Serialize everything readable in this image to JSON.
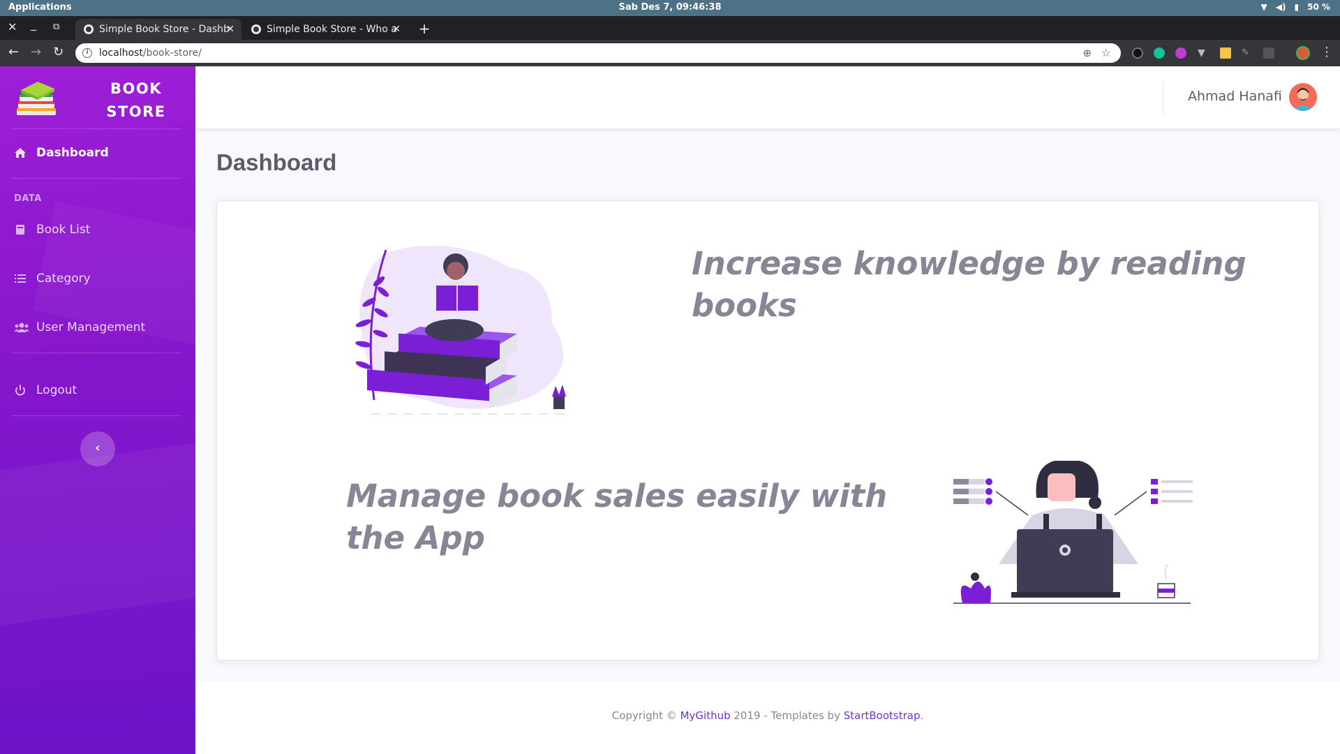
{
  "os": {
    "apps_label": "Applications",
    "clock": "Sab Des  7, 09:46:38",
    "battery": "50 %"
  },
  "browser": {
    "tabs": [
      {
        "label": "Simple Book Store - Dashb",
        "active": true
      },
      {
        "label": "Simple Book Store - Who a",
        "active": false
      }
    ],
    "url_host": "localhost",
    "url_path": "/book-store/"
  },
  "sidebar": {
    "brand_line1": "BOOK",
    "brand_line2": "STORE",
    "heading_data": "DATA",
    "items": [
      {
        "label": "Dashboard",
        "icon": "home-icon"
      },
      {
        "label": "Book List",
        "icon": "book-icon"
      },
      {
        "label": "Category",
        "icon": "list-icon"
      },
      {
        "label": "User Management",
        "icon": "users-icon"
      },
      {
        "label": "Logout",
        "icon": "power-icon"
      }
    ],
    "toggle_icon": "‹"
  },
  "topbar": {
    "username": "Ahmad Hanafi"
  },
  "main": {
    "title": "Dashboard",
    "tagline1": "Increase knowledge by reading books",
    "tagline2": "Manage book sales easily with the App"
  },
  "footer": {
    "prefix": "Copyright © ",
    "link1": "MyGithub",
    "middle": " 2019 - Templates by ",
    "link2": "StartBootstrap",
    "suffix": "."
  },
  "colors": {
    "accent": "#7a1fd6",
    "sidebar_top": "#9d1fd6",
    "sidebar_bottom": "#6c14c7",
    "text_muted": "#858796"
  }
}
